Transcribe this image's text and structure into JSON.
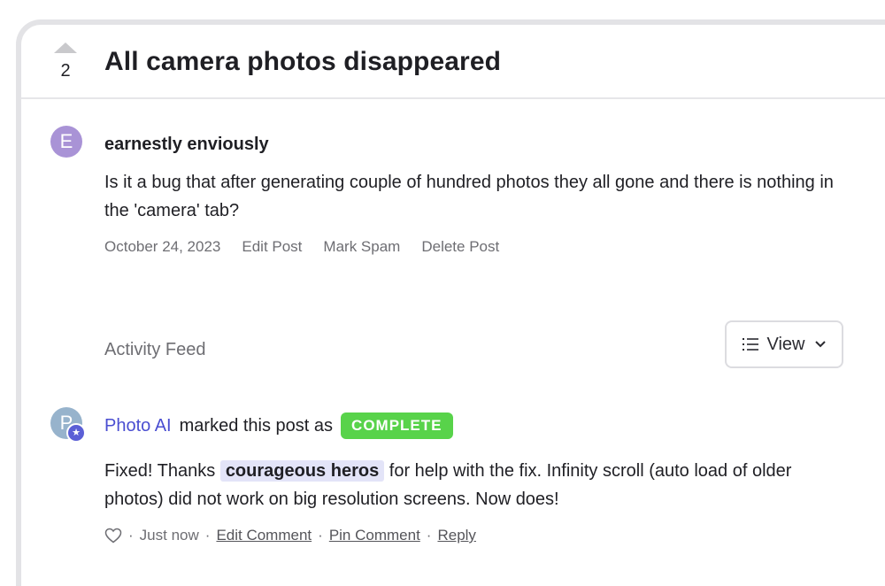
{
  "post": {
    "votes": "2",
    "title": "All camera photos disappeared",
    "author_initial": "E",
    "author": "earnestly enviously",
    "body": "Is it a bug that after generating couple of hundred photos they all gone and there is nothing in the 'camera' tab?",
    "date": "October 24, 2023",
    "actions": {
      "edit": "Edit Post",
      "spam": "Mark Spam",
      "delete": "Delete Post"
    }
  },
  "feed": {
    "label": "Activity Feed",
    "view_label": "View"
  },
  "activity": {
    "actor_initial": "P",
    "actor": "Photo AI",
    "action_text": "marked this post as",
    "status": "COMPLETE",
    "status_color": "#58d34a",
    "comment_pre": "Fixed! Thanks",
    "mention": "courageous heros",
    "comment_post": "for help with the fix. Infinity scroll (auto load of older photos) did not work on big resolution screens. Now does!",
    "separator": "·",
    "time": "Just now",
    "edit": "Edit Comment",
    "pin": "Pin Comment",
    "reply": "Reply"
  },
  "icons": {
    "upvote": "triangle-up-icon",
    "list": "list-icon",
    "chevron": "chevron-down-icon",
    "heart": "heart-outline-icon",
    "admin_badge": "star-badge-icon"
  },
  "colors": {
    "accent": "#4a4ed1",
    "avatar_e": "#a993d6",
    "avatar_p": "#97b3cc",
    "mention_bg": "#e3e4f8"
  }
}
